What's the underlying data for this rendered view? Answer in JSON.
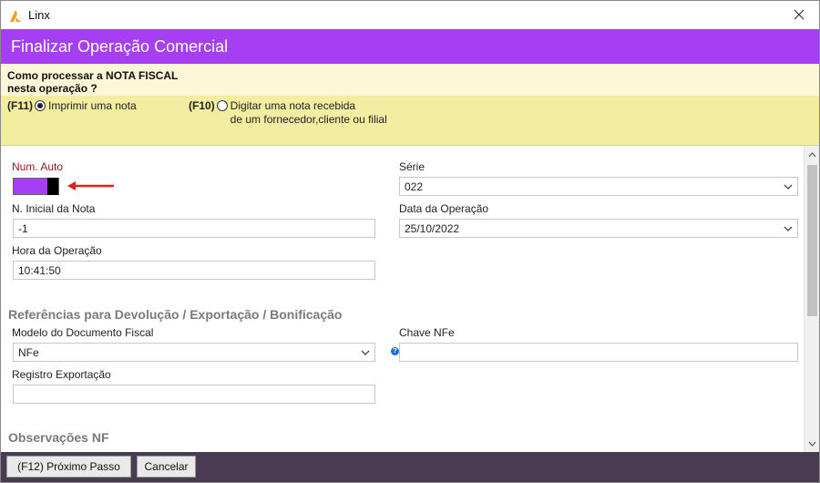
{
  "window": {
    "title": "Linx",
    "logo_color": "#f0a020"
  },
  "header": {
    "title": "Finalizar Operação Comercial",
    "color": "#a63ef4"
  },
  "nota_fiscal": {
    "question_line1": "Como processar a NOTA FISCAL",
    "question_line2": "nesta operação ?",
    "option_print": {
      "key": "(F11)",
      "label": "Imprimir uma nota",
      "selected": true
    },
    "option_type": {
      "key": "(F10)",
      "label_line1": "Digitar uma nota recebida",
      "label_line2": "de um fornecedor,cliente ou filial",
      "selected": false
    }
  },
  "form": {
    "num_auto_label": "Num. Auto",
    "num_auto_on": true,
    "serie_label": "Série",
    "serie_value": "022",
    "n_inicial_label": "N. Inicial da Nota",
    "n_inicial_value": "-1",
    "data_operacao_label": "Data da Operação",
    "data_operacao_value": "25/10/2022",
    "hora_operacao_label": "Hora da Operação",
    "hora_operacao_value": "10:41:50"
  },
  "referencias": {
    "section_title": "Referências para Devolução / Exportação / Bonificação",
    "modelo_label": "Modelo do Documento Fiscal",
    "modelo_value": "NFe",
    "chave_label": "Chave NFe",
    "chave_value": "",
    "registro_label": "Registro Exportação",
    "registro_value": ""
  },
  "observacoes": {
    "section_title": "Observações NF"
  },
  "footer": {
    "next_button": "(F12) Próximo Passo",
    "cancel_button": "Cancelar"
  },
  "icons": [
    "app-logo-icon",
    "close-icon",
    "chevron-down-icon",
    "arrow-left-icon",
    "help-icon",
    "scroll-up-icon",
    "scroll-down-icon"
  ]
}
